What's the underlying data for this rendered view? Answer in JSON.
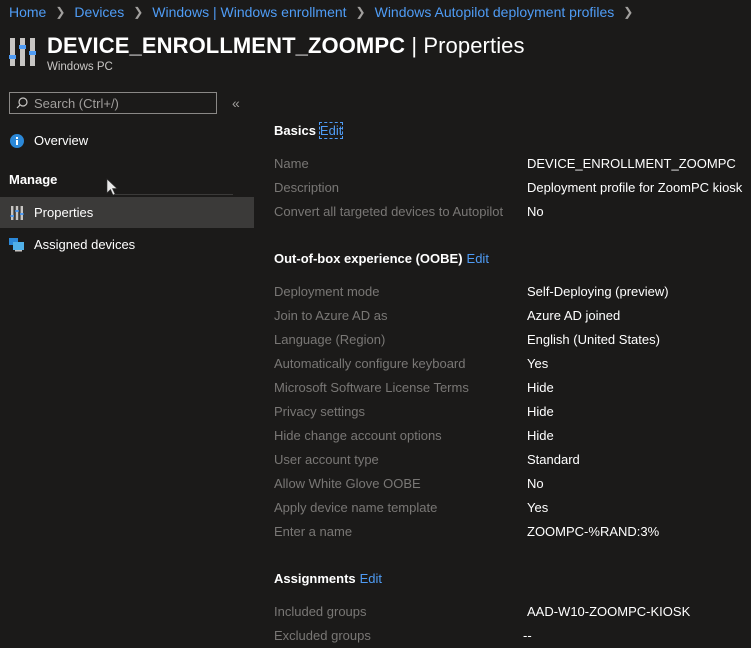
{
  "breadcrumb": [
    "Home",
    "Devices",
    "Windows | Windows enrollment",
    "Windows Autopilot deployment profiles"
  ],
  "header": {
    "title_main": "DEVICE_ENROLLMENT_ZOOMPC",
    "title_suffix": " | Properties",
    "subtitle": "Windows PC"
  },
  "search": {
    "placeholder": "Search (Ctrl+/)"
  },
  "sidebar": {
    "overview_label": "Overview",
    "group_label": "Manage",
    "properties_label": "Properties",
    "assigned_label": "Assigned devices"
  },
  "sections": {
    "basics": {
      "title": "Basics",
      "edit": "Edit",
      "rows": [
        {
          "label": "Name",
          "value": "DEVICE_ENROLLMENT_ZOOMPC"
        },
        {
          "label": "Description",
          "value": "Deployment profile for ZoomPC kiosk"
        },
        {
          "label": "Convert all targeted devices to Autopilot",
          "value": "No"
        }
      ]
    },
    "oobe": {
      "title": "Out-of-box experience (OOBE)",
      "edit": "Edit",
      "rows": [
        {
          "label": "Deployment mode",
          "value": "Self-Deploying (preview)"
        },
        {
          "label": "Join to Azure AD as",
          "value": "Azure AD joined"
        },
        {
          "label": "Language (Region)",
          "value": "English (United States)"
        },
        {
          "label": "Automatically configure keyboard",
          "value": "Yes"
        },
        {
          "label": "Microsoft Software License Terms",
          "value": "Hide"
        },
        {
          "label": "Privacy settings",
          "value": "Hide"
        },
        {
          "label": "Hide change account options",
          "value": "Hide"
        },
        {
          "label": "User account type",
          "value": "Standard"
        },
        {
          "label": "Allow White Glove OOBE",
          "value": "No"
        },
        {
          "label": "Apply device name template",
          "value": "Yes"
        },
        {
          "label": "Enter a name",
          "value": "ZOOMPC-%RAND:3%"
        }
      ]
    },
    "assignments": {
      "title": "Assignments",
      "edit": "Edit",
      "rows": [
        {
          "label": "Included groups",
          "value": "AAD-W10-ZOOMPC-KIOSK"
        },
        {
          "label": "Excluded groups",
          "value": "--"
        }
      ]
    }
  }
}
